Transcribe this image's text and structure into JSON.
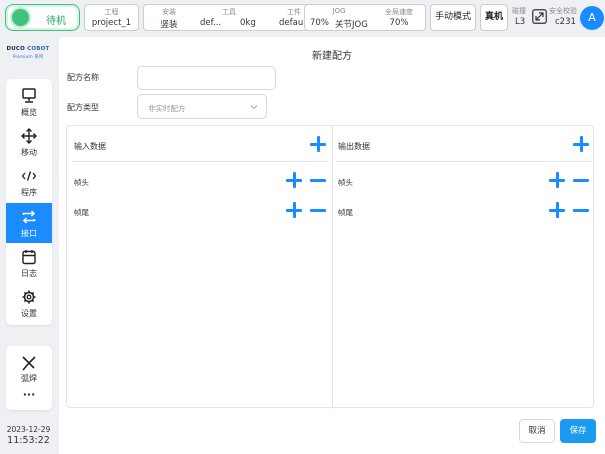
{
  "topbar": {
    "status": "待机",
    "project": {
      "caption": "工程",
      "value": "project_1"
    },
    "install": {
      "caption": "安装",
      "value": "竖装"
    },
    "tool": {
      "caption": "工具",
      "name": "def...",
      "weight": "0kg"
    },
    "workpiece": {
      "caption": "工件",
      "value": "default"
    },
    "jog": {
      "caption": "JOG",
      "speed": "70%",
      "mode": "关节JOG"
    },
    "global_speed": {
      "caption": "全局速度",
      "value": "70%"
    },
    "manual_mode": "手动模式",
    "real_machine": "真机",
    "collision": {
      "caption": "碰撞",
      "value": "L3"
    },
    "safety": {
      "caption": "安全校验",
      "value": "c231"
    },
    "avatar": "A"
  },
  "logo": {
    "brand_1": "DUCO ",
    "brand_2": "COBOT",
    "sub": "Premium 系列"
  },
  "sidebar": {
    "items": [
      {
        "label": "概览",
        "icon": "monitor-icon"
      },
      {
        "label": "移动",
        "icon": "move-arrows-icon"
      },
      {
        "label": "程序",
        "icon": "code-icon"
      },
      {
        "label": "接口",
        "icon": "swap-icon"
      },
      {
        "label": "日志",
        "icon": "calendar-icon"
      },
      {
        "label": "设置",
        "icon": "gear-icon"
      }
    ],
    "welding": {
      "label": "弧焊",
      "icon": "welding-torch-icon"
    },
    "more": "···"
  },
  "datetime": {
    "date": "2023-12-29",
    "time": "11:53:22"
  },
  "form": {
    "title": "新建配方",
    "name_label": "配方名称",
    "name_value": "",
    "type_label": "配方类型",
    "type_value": "非实时配方"
  },
  "input_panel": {
    "title": "输入数据",
    "header_label": "帧头",
    "tail_label": "帧尾"
  },
  "output_panel": {
    "title": "输出数据",
    "header_label": "帧头",
    "tail_label": "帧尾"
  },
  "actions": {
    "cancel": "取消",
    "save": "保存"
  },
  "colors": {
    "accent": "#1a8cff",
    "status_green": "#3fc37a",
    "save": "#1a9bf0"
  }
}
